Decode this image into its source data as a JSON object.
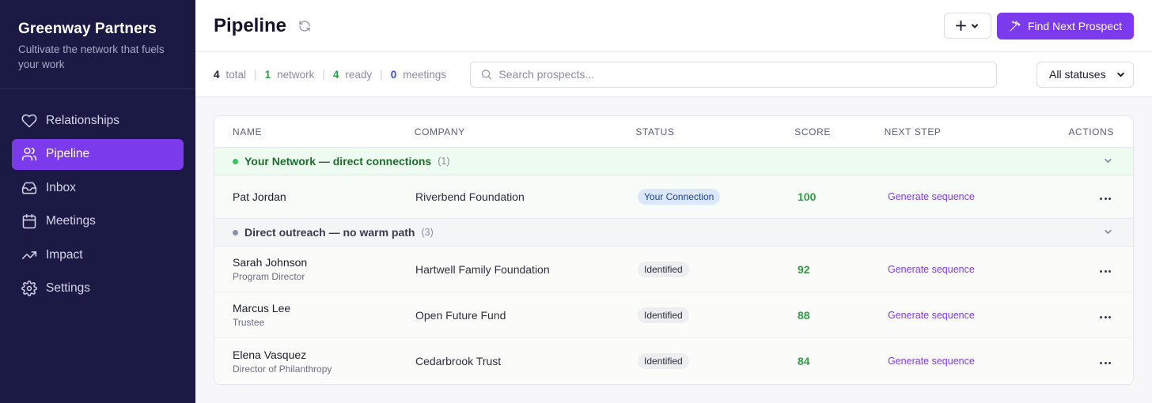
{
  "brand": {
    "name": "Greenway Partners",
    "tagline": "Cultivate the network that fuels your work"
  },
  "nav": [
    {
      "label": "Relationships",
      "icon": "heart-icon",
      "active": false
    },
    {
      "label": "Pipeline",
      "icon": "users-icon",
      "active": true
    },
    {
      "label": "Inbox",
      "icon": "inbox-icon",
      "active": false
    },
    {
      "label": "Meetings",
      "icon": "calendar-icon",
      "active": false
    },
    {
      "label": "Impact",
      "icon": "trending-up-icon",
      "active": false
    },
    {
      "label": "Settings",
      "icon": "gear-icon",
      "active": false
    }
  ],
  "header": {
    "title": "Pipeline",
    "add_label": "+",
    "primary_label": "Find Next Prospect"
  },
  "stats": [
    {
      "value": "4",
      "label": "total"
    },
    {
      "value": "1",
      "label": "network"
    },
    {
      "value": "4",
      "label": "ready"
    },
    {
      "value": "0",
      "label": "meetings"
    }
  ],
  "search": {
    "placeholder": "Search prospects..."
  },
  "status_filter": {
    "selected": "All statuses"
  },
  "table": {
    "columns": [
      "NAME",
      "COMPANY",
      "STATUS",
      "SCORE",
      "NEXT STEP",
      "ACTIONS"
    ],
    "groups": [
      {
        "title": "Your Network — direct connections",
        "count": "(1)",
        "rows": [
          {
            "name": "Pat Jordan",
            "title": "",
            "company": "Riverbend Foundation",
            "status": "Your Connection",
            "score": "100",
            "next": "Generate sequence"
          }
        ]
      },
      {
        "title": "Direct outreach — no warm path",
        "count": "(3)",
        "rows": [
          {
            "name": "Sarah Johnson",
            "title": "Program Director",
            "company": "Hartwell Family Foundation",
            "status": "Identified",
            "score": "92",
            "next": "Generate sequence"
          },
          {
            "name": "Marcus Lee",
            "title": "Trustee",
            "company": "Open Future Fund",
            "status": "Identified",
            "score": "88",
            "next": "Generate sequence"
          },
          {
            "name": "Elena Vasquez",
            "title": "Director of Philanthropy",
            "company": "Cedarbrook Trust",
            "status": "Identified",
            "score": "84",
            "next": "Generate sequence"
          }
        ]
      }
    ]
  },
  "colors": {
    "sidebar_bg": "#1b1a45",
    "accent": "#7c3aed",
    "score_green": "#2e9d43"
  }
}
